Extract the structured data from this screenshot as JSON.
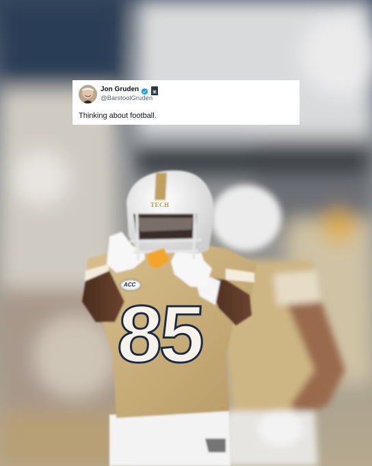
{
  "tweet": {
    "display_name": "Jon Gruden",
    "handle": "@BarstoolGruden",
    "text": "Thinking about football.",
    "verified_icon": "verified-badge-icon",
    "affiliation_icon": "affiliate-badge-icon"
  },
  "photo": {
    "helmet_text": "TECH",
    "jersey_number": "85",
    "patch_text": "ACC",
    "colors": {
      "jersey": "#c9ae7c",
      "helmet": "#f2f2f2",
      "number_fill": "#f7f3ea",
      "number_outline": "#1c2a44",
      "mouthguard": "#f2a52b",
      "verified": "#1d9bf0"
    }
  }
}
